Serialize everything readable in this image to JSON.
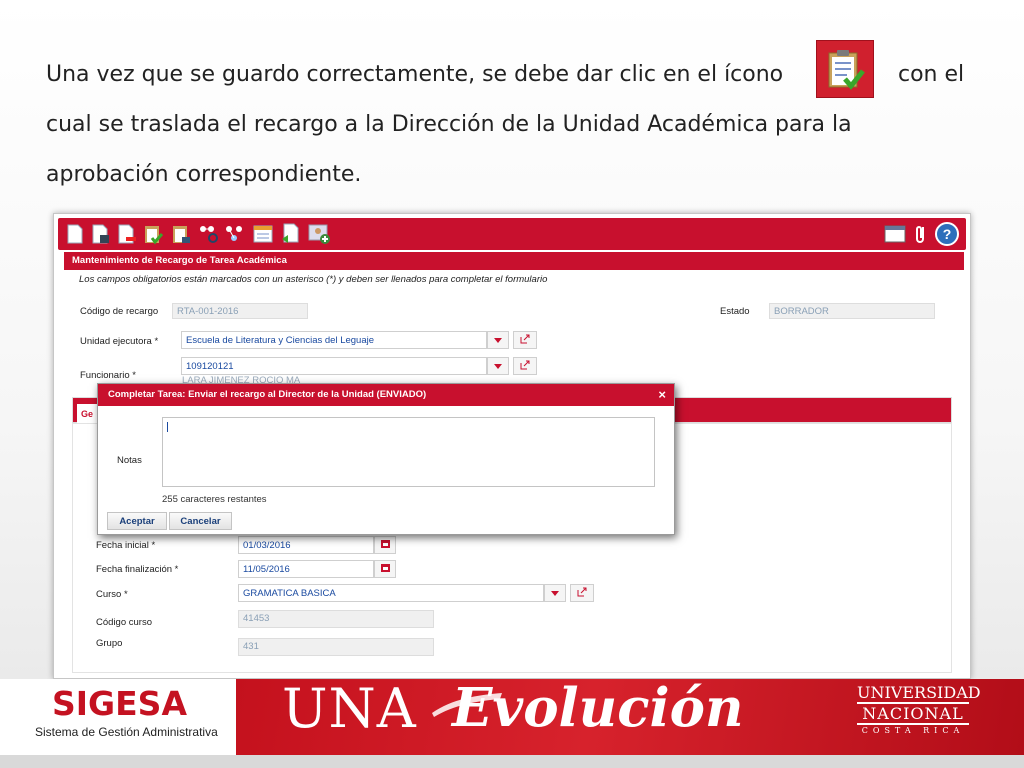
{
  "intro": {
    "line1_start": "Una vez que se guardo correctamente, se debe dar clic en el ícono",
    "line1_end": "con el",
    "line2": "cual se traslada el recargo a la Dirección de la Unidad Académica para la",
    "line3": "aprobación correspondiente."
  },
  "toolbar": {
    "left_icons": [
      "new-document-icon",
      "save-document-icon",
      "delete-document-icon",
      "complete-task-icon",
      "edit-task-icon",
      "search-workflow-icon",
      "workflow-icon",
      "report-icon",
      "move-document-icon",
      "user-add-icon"
    ],
    "right_icons": [
      "window-icon",
      "attach-icon",
      "help-icon"
    ]
  },
  "form": {
    "panel_title": "Mantenimiento de Recargo de Tarea Académica",
    "note": "Los campos obligatorios están marcados con un asterisco (*) y deben ser llenados para completar el formulario",
    "codigo_label": "Código de recargo",
    "codigo_value": "RTA-001-2016",
    "estado_label": "Estado",
    "estado_value": "BORRADOR",
    "unidad_label": "Unidad ejecutora  *",
    "unidad_value": "Escuela de Literatura y Ciencias del Leguaje",
    "funcionario_label": "Funcionario  *",
    "funcionario_id": "109120121",
    "funcionario_name": "LARA JIMENEZ ROCIO MA",
    "tab_partial": "Ge",
    "fecha_inicial_label": "Fecha inicial  *",
    "fecha_inicial_value": "01/03/2016",
    "fecha_final_label": "Fecha finalización  *",
    "fecha_final_value": "11/05/2016",
    "curso_label": "Curso  *",
    "curso_value": "GRAMATICA BASICA",
    "codigo_curso_label": "Código curso",
    "codigo_curso_value": "41453",
    "grupo_label": "Grupo",
    "grupo_value": "431"
  },
  "modal": {
    "title": "Completar Tarea: Enviar el recargo al Director de la Unidad (ENVIADO)",
    "close": "×",
    "notes_label": "Notas",
    "notes_value": "",
    "remaining": "255 caracteres restantes",
    "accept": "Aceptar",
    "cancel": "Cancelar"
  },
  "footer": {
    "sigesa": "SIGESA",
    "sigesa_sub": "Sistema de Gestión Administrativa",
    "una": "UNA",
    "evolucion": "Evolución",
    "univ_1": "UNIVERSIDAD",
    "univ_2": "NACIONAL",
    "univ_3": "COSTA RICA"
  },
  "colors": {
    "brand_red": "#c8102e",
    "link_blue": "#1a4aa0"
  }
}
